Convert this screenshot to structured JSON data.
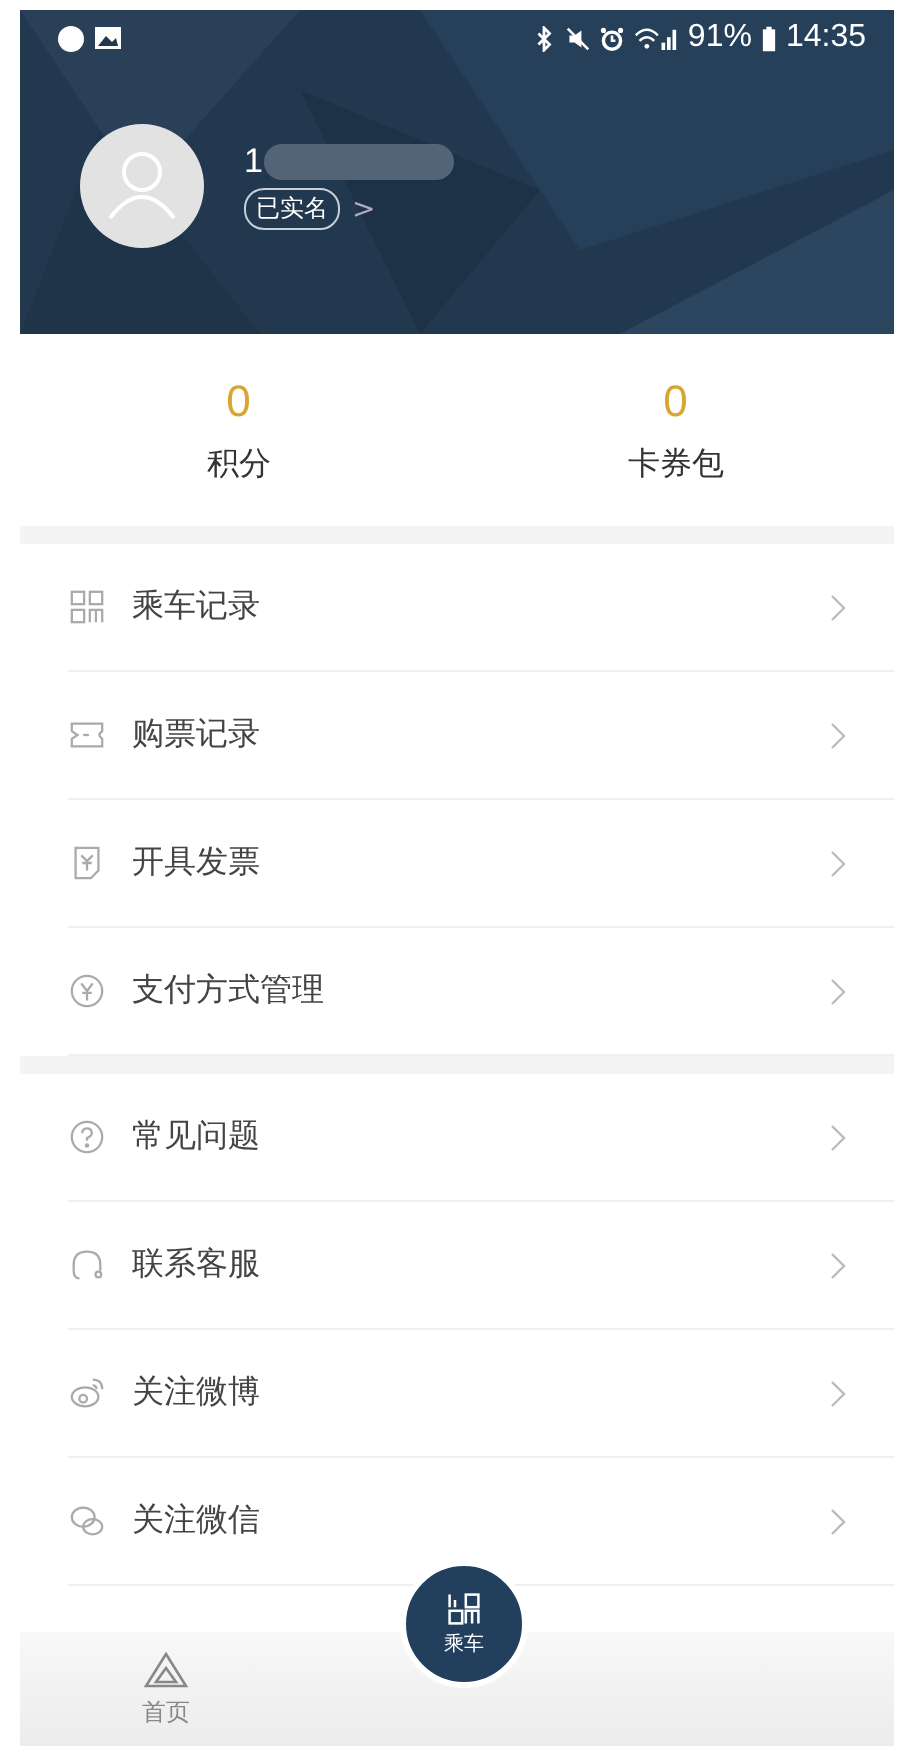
{
  "status_bar": {
    "battery": "91%",
    "time": "14:35"
  },
  "profile": {
    "phone": "1",
    "verified_badge": "已实名",
    "chevron": ">"
  },
  "stats": [
    {
      "value": "0",
      "label": "积分"
    },
    {
      "value": "0",
      "label": "卡券包"
    }
  ],
  "menu_groups": [
    {
      "items": [
        {
          "label": "乘车记录"
        },
        {
          "label": "购票记录"
        },
        {
          "label": "开具发票"
        },
        {
          "label": "支付方式管理"
        }
      ]
    },
    {
      "items": [
        {
          "label": "常见问题"
        },
        {
          "label": "联系客服"
        },
        {
          "label": "关注微博"
        },
        {
          "label": "关注微信"
        }
      ]
    }
  ],
  "tab_bar": {
    "tabs": [
      {
        "label": "首页",
        "selected": false
      }
    ],
    "center_button": {
      "label": "乘车"
    }
  }
}
